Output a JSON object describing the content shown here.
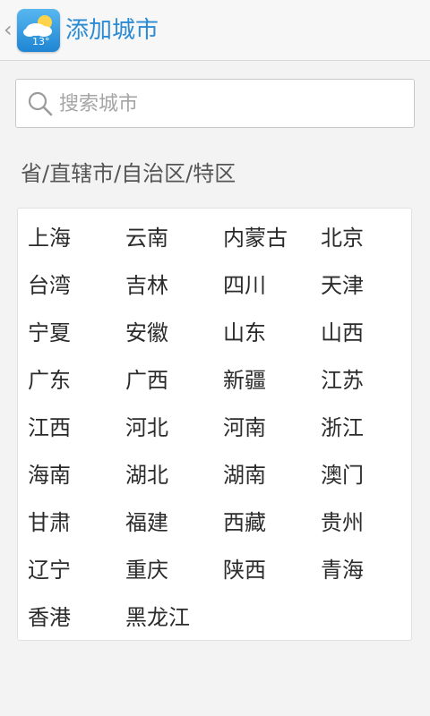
{
  "header": {
    "title": "添加城市",
    "icon_temp": "13°",
    "back_icon": "‹"
  },
  "search": {
    "placeholder": "搜索城市"
  },
  "section": {
    "title": "省/直辖市/自治区/特区"
  },
  "cities": [
    "上海",
    "云南",
    "内蒙古",
    "北京",
    "台湾",
    "吉林",
    "四川",
    "天津",
    "宁夏",
    "安徽",
    "山东",
    "山西",
    "广东",
    "广西",
    "新疆",
    "江苏",
    "江西",
    "河北",
    "河南",
    "浙江",
    "海南",
    "湖北",
    "湖南",
    "澳门",
    "甘肃",
    "福建",
    "西藏",
    "贵州",
    "辽宁",
    "重庆",
    "陕西",
    "青海",
    "香港",
    "黑龙江"
  ],
  "colors": {
    "accent": "#2a8bd4",
    "background": "#f3f3f3",
    "panel": "#ffffff"
  }
}
